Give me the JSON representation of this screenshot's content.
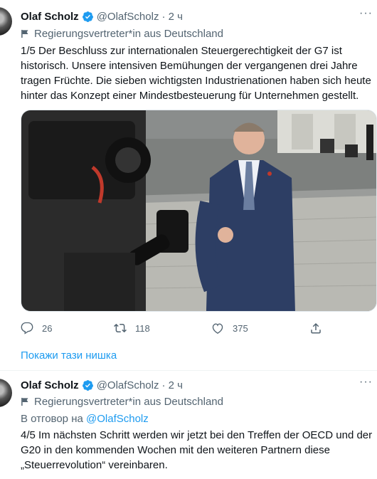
{
  "tweets": [
    {
      "name": "Olaf Scholz",
      "handle": "@OlafScholz",
      "time": "· 2 ч",
      "label": "Regierungsvertreter*in aus Deutschland",
      "text": "1/5 Der Beschluss zur internationalen Steuergerechtigkeit der G7 ist historisch. Unsere intensiven Bemühungen der vergangenen drei Jahre tragen Früchte. Die sieben wichtigsten Industrienationen haben sich heute hinter das Konzept einer Mindestbesteuerung für Unternehmen gestellt.",
      "actions": {
        "replies": "26",
        "retweets": "118",
        "likes": "375"
      },
      "show_thread": "Покажи тази нишка"
    },
    {
      "name": "Olaf Scholz",
      "handle": "@OlafScholz",
      "time": "· 2 ч",
      "label": "Regierungsvertreter*in aus Deutschland",
      "reply_prefix": "В отговор на",
      "reply_mention": "@OlafScholz",
      "text": "4/5 Im nächsten Schritt werden wir jetzt bei den Treffen der OECD und der G20 in den kommenden Wochen mit den weiteren Partnern diese „Steuerrevolution“ vereinbaren."
    }
  ],
  "colors": {
    "accent": "#1d9bf0",
    "muted": "#536471",
    "text": "#0f1419"
  }
}
